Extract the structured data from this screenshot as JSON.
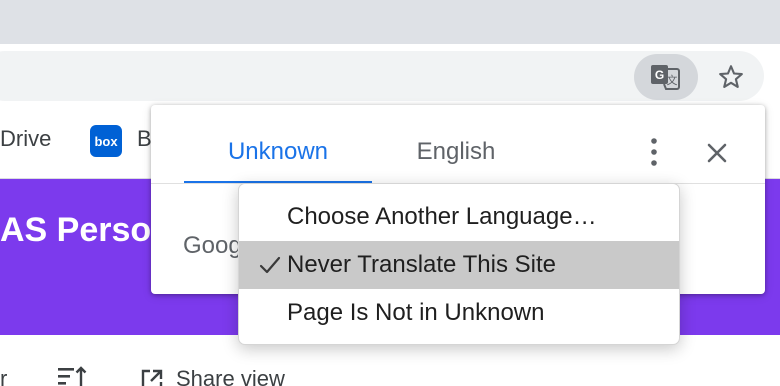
{
  "bookmarks": {
    "drive_label": "Drive",
    "box_icon_text": "box",
    "next_label": "B"
  },
  "page": {
    "banner_title": "AS Person",
    "banner_color": "#7c3aed",
    "bottom_left_text": "r",
    "share_label": "Share view"
  },
  "translate_bubble": {
    "tabs": [
      {
        "label": "Unknown",
        "selected": true
      },
      {
        "label": "English",
        "selected": false
      }
    ],
    "footer_text": "Goog",
    "accent_color": "#1a73e8",
    "icons": [
      "translate-icon",
      "star-icon",
      "more-vert-icon",
      "close-icon",
      "check-icon"
    ]
  },
  "options_menu": {
    "items": [
      {
        "label": "Choose Another Language…",
        "checked": false,
        "highlighted": false
      },
      {
        "label": "Never Translate This Site",
        "checked": true,
        "highlighted": true
      },
      {
        "label": "Page Is Not in Unknown",
        "checked": false,
        "highlighted": false
      }
    ]
  }
}
